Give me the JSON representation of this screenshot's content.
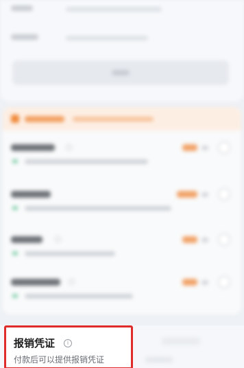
{
  "form": {
    "fields": [
      {
        "label_icon": "blurred-text"
      },
      {
        "label_icon": "blurred-text"
      }
    ],
    "button_icon": "blurred-text"
  },
  "services": {
    "header_icon": "shield-icon",
    "accent_color": "#f08a3a",
    "rows": [
      {
        "check_icon": "check-icon"
      },
      {
        "check_icon": "check-icon"
      },
      {
        "check_icon": "check-icon"
      },
      {
        "check_icon": "check-icon"
      }
    ]
  },
  "receipt": {
    "title": "报销凭证",
    "info_icon": "info-icon",
    "info_glyph": "i",
    "description": "付款后可以提供报销凭证",
    "highlight_color": "#e02b2b"
  }
}
